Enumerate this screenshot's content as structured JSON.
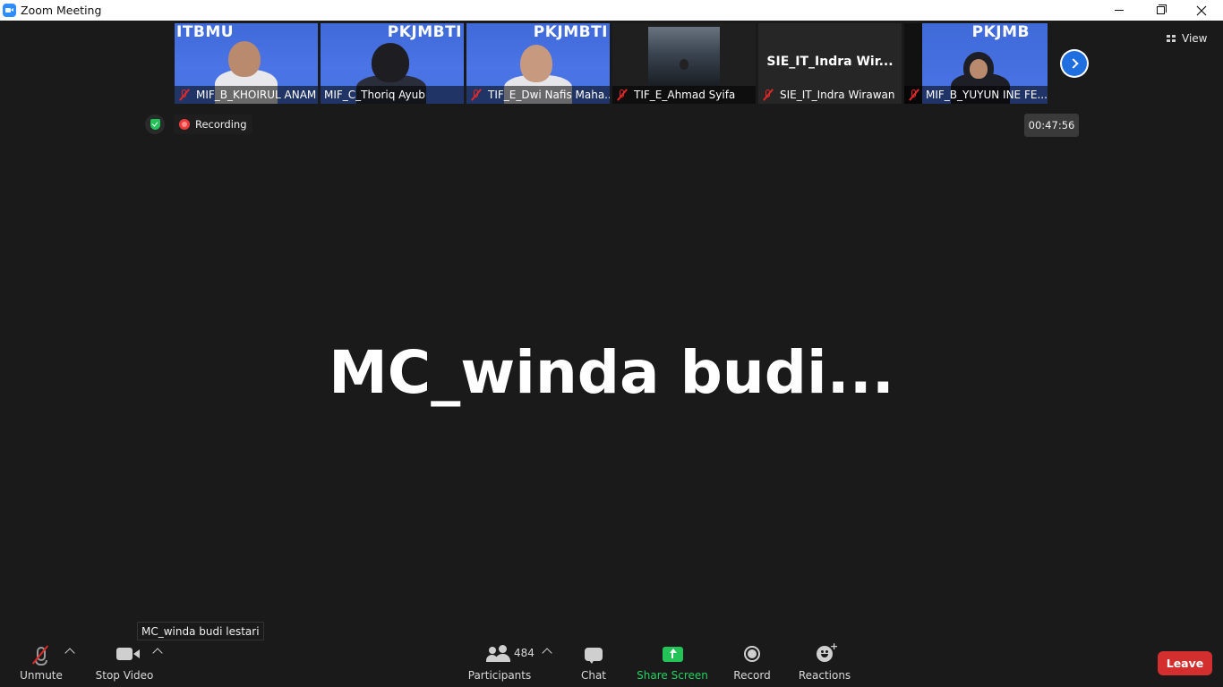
{
  "window": {
    "title": "Zoom Meeting"
  },
  "gallery": {
    "tiles": [
      {
        "name": "MIF_B_KHOIRUL ANAM",
        "muted": true,
        "banner": "ITBMU"
      },
      {
        "name": "MIF_C_Thoriq Ayub",
        "muted": false,
        "banner": "PKJMBTI"
      },
      {
        "name": "TIF_E_Dwi Nafis Maha...",
        "muted": true,
        "banner": "PKJMBTI"
      },
      {
        "name": "TIF_E_Ahmad Syifa",
        "muted": true,
        "banner": ""
      },
      {
        "name": "SIE_IT_Indra Wirawan",
        "muted": true,
        "display_name": "SIE_IT_Indra  Wir..."
      },
      {
        "name": "MIF_B_YUYUN INE FE...",
        "muted": true,
        "banner": "PKJMB"
      }
    ]
  },
  "view_button": {
    "label": "View",
    "icon": "grid-icon"
  },
  "status": {
    "recording_label": "Recording",
    "timer": "00:47:56"
  },
  "active_speaker": {
    "display_name": "MC_winda  budi...",
    "tooltip": "MC_winda budi lestari"
  },
  "toolbar": {
    "unmute_label": "Unmute",
    "stop_video_label": "Stop Video",
    "participants_label": "Participants",
    "participants_count": "484",
    "chat_label": "Chat",
    "share_screen_label": "Share Screen",
    "record_label": "Record",
    "reactions_label": "Reactions",
    "leave_label": "Leave"
  },
  "colors": {
    "background": "#1a1a1a",
    "share_green": "#23c35a",
    "leave_red": "#d32f2f",
    "muted_red": "#e02828",
    "accent_blue": "#1f6fe0"
  }
}
